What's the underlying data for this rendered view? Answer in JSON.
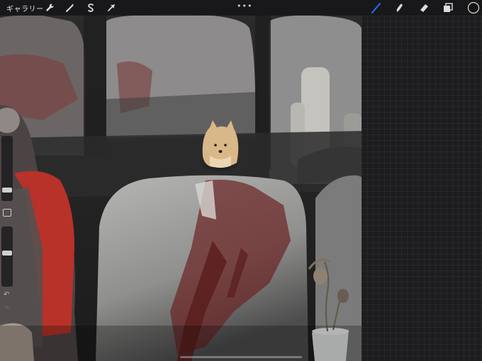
{
  "app": {
    "gallery_label": "ギャラリー",
    "more_label": "•••"
  },
  "toolbar": {
    "left_icons": [
      "wrench-icon",
      "magic-wand-icon",
      "selection-s-icon",
      "transform-arrow-icon"
    ],
    "right_tools": [
      "brush-icon",
      "smudge-icon",
      "eraser-icon",
      "layers-icon",
      "color-circle-icon"
    ],
    "active_tool": "brush-icon",
    "active_color": "#2a6cff"
  },
  "sidebar": {
    "brush_size_level": 0.12,
    "opacity_level": 0.55,
    "undo_glyph": "↶",
    "redo_glyph": "↷"
  },
  "colors": {
    "toolbar_bg": "#18181a",
    "panel_bg": "#1d1d1f",
    "accent": "#2a6cff"
  }
}
